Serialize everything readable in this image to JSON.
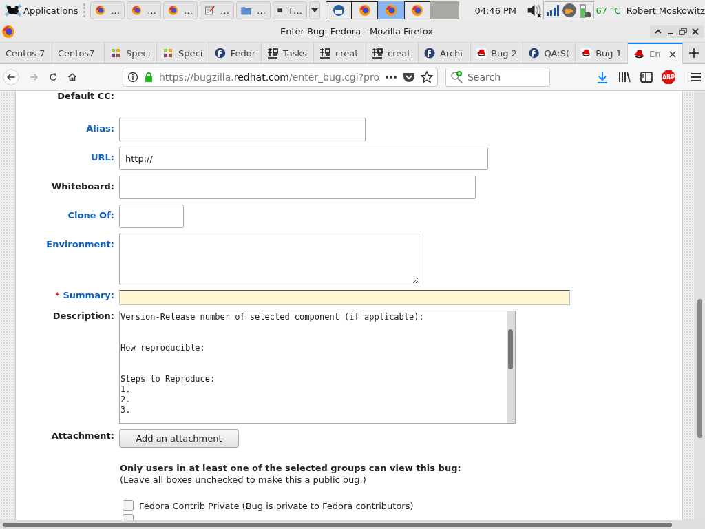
{
  "panel": {
    "menu_label": "Applications",
    "tasks": [
      {
        "kind": "firefox",
        "label": "…"
      },
      {
        "kind": "firefox",
        "label": "…"
      },
      {
        "kind": "firefox",
        "label": "…"
      },
      {
        "kind": "notepad",
        "label": "…"
      },
      {
        "kind": "folder",
        "label": "…"
      },
      {
        "kind": "terminal",
        "label": "T…"
      }
    ],
    "workspaces": [
      {
        "kind": "mail",
        "selected": false
      },
      {
        "kind": "firefox",
        "selected": false
      },
      {
        "kind": "firefox",
        "selected": true
      },
      {
        "kind": "firefox",
        "selected": false
      }
    ],
    "clock": "04:46 PM",
    "temperature": "67 °C",
    "user": "Robert Moskowitz"
  },
  "window": {
    "title": "Enter Bug: Fedora - Mozilla Firefox"
  },
  "tabs": [
    {
      "kind": "plain",
      "label": "Centos 7",
      "selected": false
    },
    {
      "kind": "plain",
      "label": "Centos7",
      "selected": false
    },
    {
      "kind": "pinwheel",
      "label": "Speci",
      "selected": false
    },
    {
      "kind": "pinwheel",
      "label": "Speci",
      "selected": false
    },
    {
      "kind": "fedora",
      "label": "Fedor",
      "selected": false
    },
    {
      "kind": "glyph",
      "label": "Tasks",
      "selected": false
    },
    {
      "kind": "glyph",
      "label": "creat",
      "selected": false
    },
    {
      "kind": "glyph",
      "label": "creat",
      "selected": false
    },
    {
      "kind": "fedora",
      "label": "Archi",
      "selected": false
    },
    {
      "kind": "hat",
      "label": "Bug 2",
      "selected": false
    },
    {
      "kind": "fedora",
      "label": "QA:S(",
      "selected": false
    },
    {
      "kind": "hat",
      "label": "Bug 1",
      "selected": false
    },
    {
      "kind": "hat",
      "label": "En",
      "selected": true
    }
  ],
  "address": {
    "scheme": "https://bugzilla.",
    "domain": "redhat.com",
    "path": "/enter_bug.cgi?pro"
  },
  "search": {
    "placeholder": "Search"
  },
  "adblock_label": "ABP",
  "form": [
    {
      "label": "Default CC:",
      "kind": "none",
      "link": false
    },
    {
      "label": "Alias:",
      "kind": "input",
      "link": true
    },
    {
      "label": "URL:",
      "kind": "input",
      "link": true,
      "value": "http://"
    },
    {
      "label": "Whiteboard:",
      "kind": "input",
      "link": false
    },
    {
      "label": "Clone Of:",
      "kind": "input",
      "link": true
    },
    {
      "label": "Environment:",
      "kind": "textarea",
      "link": true
    },
    {
      "label": "Summary:",
      "kind": "required-input",
      "link": true,
      "required_mark": "*"
    },
    {
      "label": "Description:",
      "kind": "description",
      "link": false,
      "value": "Version-Release number of selected component (if applicable):\n\n\nHow reproducible:\n\n\nSteps to Reproduce:\n1.\n2.\n3."
    },
    {
      "label": "Attachment:",
      "kind": "button",
      "link": false,
      "value": "Add an attachment"
    }
  ],
  "groups": {
    "heading": "Only users in at least one of the selected groups can view this bug:",
    "note": "(Leave all boxes unchecked to make this a public bug.)",
    "options": [
      {
        "label": "Fedora Contrib Private (Bug is private to Fedora contributors)",
        "checked": false
      },
      {
        "checked": false
      }
    ]
  }
}
